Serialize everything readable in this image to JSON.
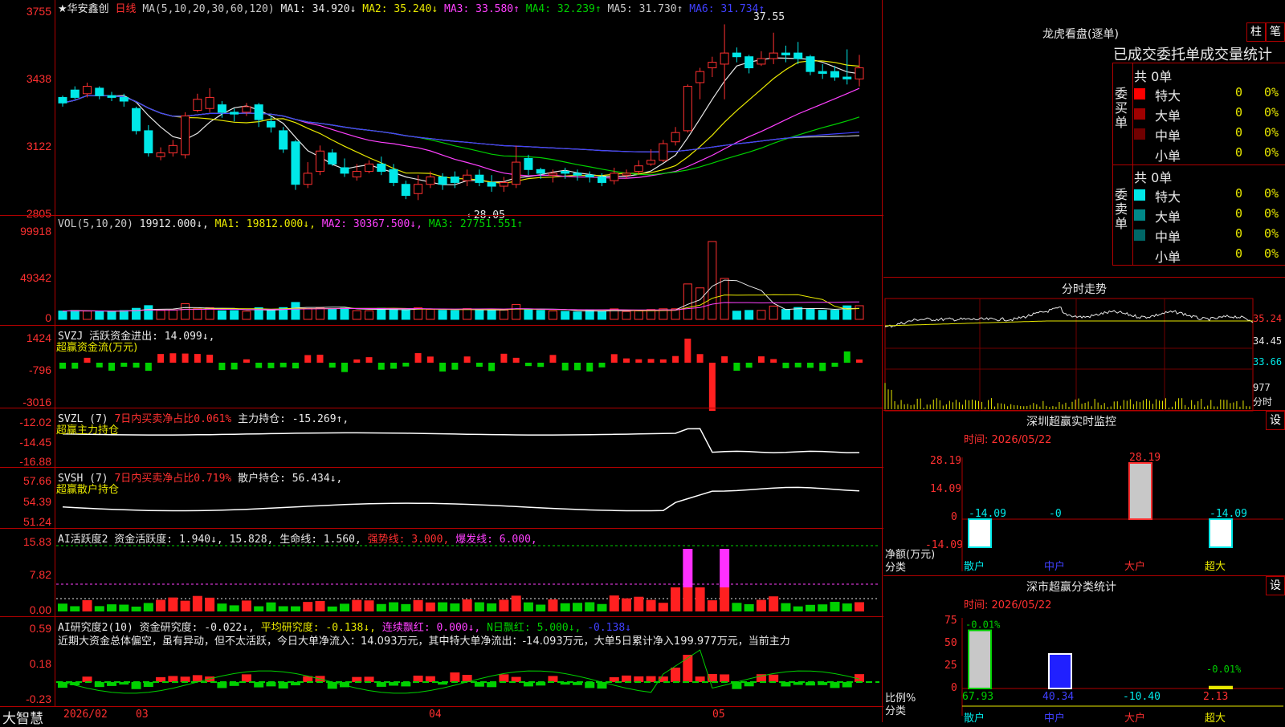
{
  "stock": {
    "name": "★华安鑫创",
    "period": "日线"
  },
  "ma_header": {
    "label": "MA(5,10,20,30,60,120)",
    "items": [
      {
        "text": "MA1: 34.920↓",
        "color": "#e8e8e8"
      },
      {
        "text": "MA2: 35.240↓",
        "color": "#e8e800"
      },
      {
        "text": "MA3: 33.580↑",
        "color": "#ff40ff"
      },
      {
        "text": "MA4: 32.239↑",
        "color": "#00d000"
      },
      {
        "text": "MA5: 31.730↑",
        "color": "#c8c8c8"
      },
      {
        "text": "MA6: 31.734↑",
        "color": "#4040ff"
      }
    ]
  },
  "price_axis": [
    "3755",
    "3438",
    "3122",
    "2805"
  ],
  "annotations": {
    "high": "37.55",
    "low": "←28.05"
  },
  "chart_data": {
    "type": "candlestick",
    "x_ticks": [
      "2026/02",
      "03",
      "04",
      "05"
    ],
    "ylim": [
      27.5,
      38.0
    ],
    "candles": [
      [
        33.6,
        33.3,
        33.1,
        33.7
      ],
      [
        34.0,
        33.6,
        33.5,
        34.2
      ],
      [
        33.8,
        34.2,
        33.6,
        34.4
      ],
      [
        34.1,
        33.7,
        33.5,
        34.2
      ],
      [
        33.7,
        33.6,
        33.4,
        33.9
      ],
      [
        33.6,
        33.4,
        33.1,
        33.8
      ],
      [
        33.0,
        31.8,
        31.6,
        33.1
      ],
      [
        31.8,
        30.6,
        30.4,
        32.1
      ],
      [
        30.4,
        30.6,
        30.2,
        30.9
      ],
      [
        30.6,
        31.0,
        30.4,
        31.3
      ],
      [
        30.5,
        32.6,
        30.3,
        32.8
      ],
      [
        32.9,
        33.5,
        32.8,
        33.8
      ],
      [
        33.0,
        33.6,
        32.8,
        34.1
      ],
      [
        33.2,
        32.8,
        32.5,
        33.4
      ],
      [
        32.8,
        32.7,
        32.3,
        33.0
      ],
      [
        32.8,
        33.1,
        32.6,
        33.3
      ],
      [
        33.2,
        32.4,
        32.0,
        33.3
      ],
      [
        32.3,
        32.0,
        31.7,
        32.6
      ],
      [
        31.8,
        30.8,
        30.6,
        32.0
      ],
      [
        31.2,
        28.9,
        28.6,
        31.3
      ],
      [
        28.9,
        29.5,
        28.7,
        30.1
      ],
      [
        29.6,
        30.7,
        29.4,
        31.0
      ],
      [
        30.6,
        30.0,
        29.9,
        30.8
      ],
      [
        29.8,
        29.5,
        29.3,
        30.3
      ],
      [
        29.3,
        29.6,
        29.1,
        30.0
      ],
      [
        29.6,
        30.0,
        29.5,
        30.2
      ],
      [
        30.0,
        29.6,
        29.4,
        30.4
      ],
      [
        29.7,
        29.0,
        28.8,
        30.0
      ],
      [
        28.9,
        28.3,
        28.1,
        29.1
      ],
      [
        28.4,
        28.9,
        28.05,
        29.4
      ],
      [
        28.9,
        29.3,
        28.7,
        29.6
      ],
      [
        29.3,
        28.9,
        28.6,
        29.5
      ],
      [
        29.3,
        29.0,
        28.7,
        29.6
      ],
      [
        29.1,
        29.4,
        28.8,
        29.7
      ],
      [
        29.4,
        29.0,
        28.8,
        29.7
      ],
      [
        29.0,
        28.8,
        28.5,
        29.4
      ],
      [
        28.8,
        29.0,
        28.5,
        29.3
      ],
      [
        28.9,
        30.1,
        28.7,
        31.0
      ],
      [
        30.3,
        29.7,
        29.4,
        30.5
      ],
      [
        29.7,
        29.5,
        29.2,
        29.8
      ],
      [
        29.4,
        29.5,
        29.0,
        29.7
      ],
      [
        29.6,
        29.5,
        29.2,
        29.8
      ],
      [
        29.5,
        29.4,
        29.1,
        29.7
      ],
      [
        29.4,
        29.3,
        29.0,
        29.6
      ],
      [
        29.3,
        29.0,
        28.8,
        29.5
      ],
      [
        29.1,
        29.5,
        28.9,
        29.8
      ],
      [
        29.4,
        29.5,
        29.2,
        29.7
      ],
      [
        29.6,
        29.9,
        29.4,
        30.2
      ],
      [
        30.0,
        30.2,
        29.9,
        30.8
      ],
      [
        30.2,
        31.1,
        30.1,
        31.3
      ],
      [
        31.2,
        31.7,
        31.0,
        32.0
      ],
      [
        31.8,
        34.2,
        31.7,
        34.3
      ],
      [
        34.4,
        35.0,
        33.5,
        35.2
      ],
      [
        35.2,
        35.5,
        34.7,
        35.8
      ],
      [
        35.4,
        36.0,
        33.5,
        37.55
      ],
      [
        36.0,
        35.8,
        35.5,
        36.3
      ],
      [
        35.8,
        35.2,
        34.9,
        35.9
      ],
      [
        35.4,
        35.7,
        35.3,
        36.1
      ],
      [
        35.7,
        36.0,
        35.4,
        37.1
      ],
      [
        36.0,
        35.9,
        35.5,
        36.4
      ],
      [
        36.0,
        35.7,
        35.4,
        36.6
      ],
      [
        35.8,
        35.0,
        34.8,
        35.9
      ],
      [
        35.0,
        34.9,
        34.6,
        35.4
      ],
      [
        35.0,
        34.7,
        34.5,
        35.3
      ],
      [
        34.7,
        34.6,
        34.3,
        36.2
      ],
      [
        34.6,
        35.2,
        34.2,
        35.9
      ]
    ],
    "ma_colors": [
      "#e8e8e8",
      "#e8e800",
      "#ff40ff",
      "#00d000",
      "#c8c8c8",
      "#4040ff"
    ]
  },
  "vol": {
    "header": [
      {
        "text": "VOL(5,10,20) ",
        "color": "#c8c8c8"
      },
      {
        "text": "19912.000↓, ",
        "color": "#e8e8e8"
      },
      {
        "text": "MA1: 19812.000↓, ",
        "color": "#e8e800"
      },
      {
        "text": "MA2: 30367.500↓, ",
        "color": "#ff40ff"
      },
      {
        "text": "MA3: 27751.551↑",
        "color": "#00d000"
      }
    ],
    "axis": [
      "99918",
      "49342",
      "0"
    ]
  },
  "svzj": {
    "header": [
      {
        "text": "SVZJ  活跃资金进出: 14.099↓,",
        "color": "#e8e8e8"
      }
    ],
    "sub": "超赢资金流(万元)",
    "axis": [
      "1424",
      "-796",
      "-3016"
    ]
  },
  "svzl": {
    "header": [
      {
        "text": "SVZL (7) ",
        "color": "#e8e8e8"
      },
      {
        "text": "7日内买卖净占比0.061% ",
        "color": "#ff3030"
      },
      {
        "text": "主力持仓: -15.269↑,",
        "color": "#e8e8e8"
      }
    ],
    "sub": "超赢主力持仓",
    "axis": [
      "-12.02",
      "-14.45",
      "-16.88"
    ]
  },
  "svsh": {
    "header": [
      {
        "text": "SVSH (7) ",
        "color": "#e8e8e8"
      },
      {
        "text": "7日内买卖净占比0.719% ",
        "color": "#ff3030"
      },
      {
        "text": "散户持仓: 56.434↓,",
        "color": "#e8e8e8"
      }
    ],
    "sub": "超赢散户持仓",
    "axis": [
      "57.66",
      "54.39",
      "51.24"
    ]
  },
  "ai1": {
    "header": [
      {
        "text": "AI活跃度2 资金活跃度: 1.940↓, ",
        "color": "#e8e8e8"
      },
      {
        "text": "15.828, ",
        "color": "#e8e8e8"
      },
      {
        "text": "生命线: 1.560, ",
        "color": "#e8e8e8"
      },
      {
        "text": "强势线: 3.000, ",
        "color": "#ff3030"
      },
      {
        "text": "爆发线: 6.000,",
        "color": "#ff40ff"
      }
    ],
    "axis": [
      "15.83",
      "7.82",
      "0.00"
    ]
  },
  "ai2": {
    "header": [
      {
        "text": "AI研究度2(10) 资金研究度: -0.022↓, ",
        "color": "#e8e8e8"
      },
      {
        "text": "平均研究度: -0.138↓, ",
        "color": "#e8e800"
      },
      {
        "text": "连续飘红: 0.000↓, ",
        "color": "#ff40ff"
      },
      {
        "text": "N日飘红: 5.000↓, ",
        "color": "#00d000"
      },
      {
        "text": "-0.138↓",
        "color": "#4040ff"
      }
    ],
    "comment": "近期大资金总体偏空，虽有异动，但不太活跃，今日大单净流入：14.093万元，其中特大单净流出：-14.093万元，大单5日累计净入199.977万元，当前主力",
    "axis": [
      "0.59",
      "0.18",
      "-0.23"
    ]
  },
  "bottom": {
    "brand": "大智慧"
  },
  "right": {
    "lhb": {
      "title": "龙虎看盘(逐单)",
      "btn1": "柱",
      "btn2": "笔",
      "subtitle": "已成交委托单成交量统计",
      "buy": {
        "side": "委买单",
        "total": "共 0单",
        "rows": [
          {
            "name": "特大",
            "v": "0",
            "p": "0%",
            "color": "#ff0000"
          },
          {
            "name": "大单",
            "v": "0",
            "p": "0%",
            "color": "#a00000"
          },
          {
            "name": "中单",
            "v": "0",
            "p": "0%",
            "color": "#700000"
          },
          {
            "name": "小单",
            "v": "0",
            "p": "0%",
            "color": ""
          }
        ]
      },
      "sell": {
        "side": "委卖单",
        "total": "共 0单",
        "rows": [
          {
            "name": "特大",
            "v": "0",
            "p": "0%",
            "color": "#00e8e8"
          },
          {
            "name": "大单",
            "v": "0",
            "p": "0%",
            "color": "#008888"
          },
          {
            "name": "中单",
            "v": "0",
            "p": "0%",
            "color": "#006666"
          },
          {
            "name": "小单",
            "v": "0",
            "p": "0%",
            "color": ""
          }
        ]
      }
    },
    "fenshi": {
      "title": "分时走势",
      "axis": [
        "35.24",
        "34.45",
        "33.66",
        "977",
        "分时"
      ]
    },
    "sz_monitor": {
      "title": "深圳超赢实时监控",
      "btn": "设",
      "time": "时间: 2026/05/22",
      "axis": [
        "28.19",
        "14.09",
        "0",
        "-14.09"
      ],
      "ylabel1": "净额(万元)",
      "ylabel2": "分类",
      "categories": [
        "散户",
        "中户",
        "大户",
        "超大"
      ],
      "values": [
        -14.09,
        0,
        28.19,
        -14.09
      ],
      "value_labels": [
        "-14.09",
        "-0",
        "28.19",
        "-14.09"
      ]
    },
    "sz_class": {
      "title": "深市超赢分类统计",
      "btn": "设",
      "time": "时间: 2026/05/22",
      "axis": [
        "75",
        "50",
        "25",
        "0"
      ],
      "ylabel1": "比例%",
      "ylabel2": "分类",
      "categories": [
        "散户",
        "中户",
        "大户",
        "超大"
      ],
      "bars": [
        67.93,
        40.34,
        0,
        2.13
      ],
      "bottom_values": [
        "67.93",
        "40.34",
        "-10.40",
        "2.13"
      ],
      "top_labels": [
        "-0.01%",
        "",
        "",
        "-0.01%"
      ]
    }
  }
}
